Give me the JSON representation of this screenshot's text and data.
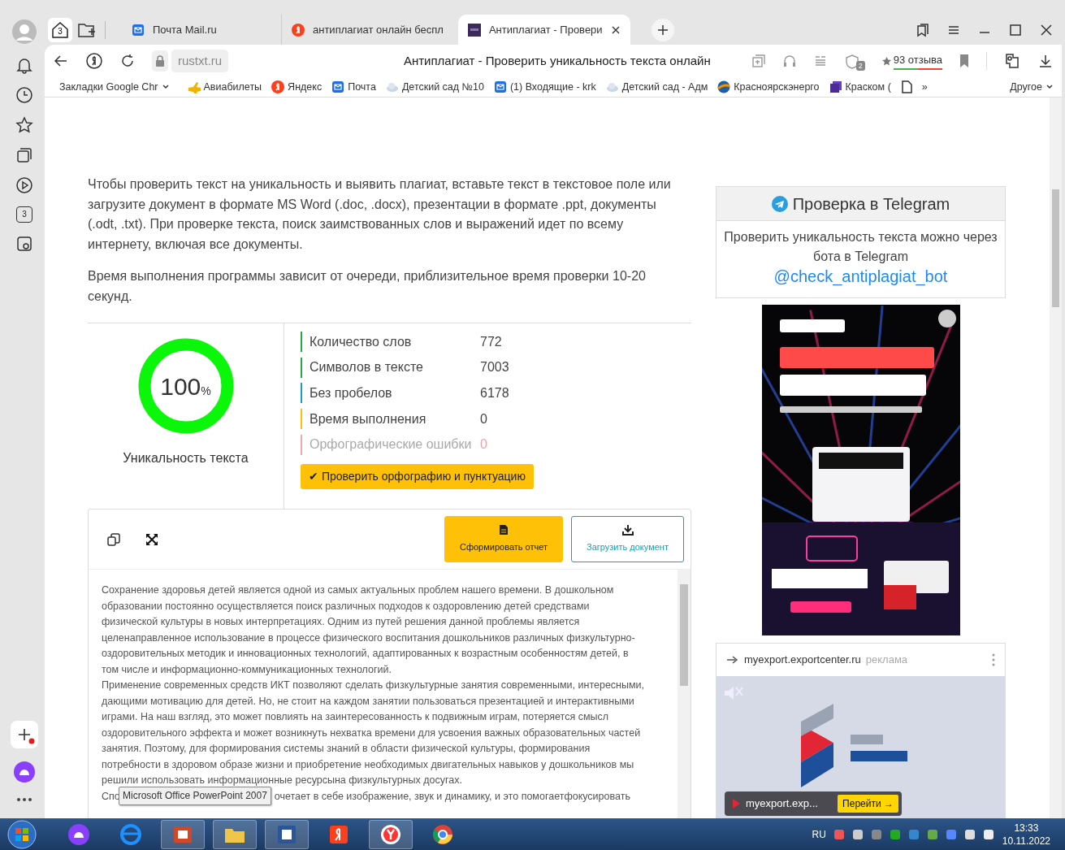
{
  "sidebar": {
    "tabs_badge": "3"
  },
  "tab_strip": {
    "group_badge": "3",
    "tabs": [
      {
        "title": "Почта Mail.ru",
        "selected": false
      },
      {
        "title": "антиплагиат онлайн беспл",
        "selected": false
      },
      {
        "title": "Антиплагиат - Провери",
        "selected": true
      }
    ]
  },
  "address_bar": {
    "url": "rustxt.ru",
    "page_title": "Антиплагиат - Проверить уникальность текста онлайн",
    "shield_count": "2",
    "reviews": "93 отзыва"
  },
  "bookmarks": {
    "items": [
      {
        "label": "Закладки Google Chr",
        "kind": "folder"
      },
      {
        "label": "Авиабилеты",
        "kind": "link"
      },
      {
        "label": "Яндекс",
        "kind": "link"
      },
      {
        "label": "Почта",
        "kind": "link"
      },
      {
        "label": "Детский сад №10",
        "kind": "link"
      },
      {
        "label": "(1) Входящие - krk",
        "kind": "link"
      },
      {
        "label": "Детский сад - Адм",
        "kind": "link"
      },
      {
        "label": "Красноярскэнерго",
        "kind": "link"
      },
      {
        "label": "Краском (",
        "kind": "link"
      }
    ],
    "more": "»",
    "other": "Другое"
  },
  "intro": [
    "Чтобы проверить текст на уникальность и выявить плагиат, вставьте текст в текстовое поле или загрузите документ в формате MS Word (.doc, .docx), презентации в формате .ppt, документы (.odt, .txt). При проверке текста, поиск заимствованных слов и выражений идет по всему интернету, включая все документы.",
    "Время выполнения программы зависит от очереди, приблизительное время проверки 10-20 секунд."
  ],
  "uniqueness": {
    "value": "100",
    "unit": "%",
    "level": 1,
    "label": "Уникальность текста"
  },
  "stats": [
    {
      "label": "Количество слов",
      "value": "772",
      "color": "#28a745",
      "disabled": false
    },
    {
      "label": "Символов в тексте",
      "value": "7003",
      "color": "#28a745",
      "disabled": false
    },
    {
      "label": "Без пробелов",
      "value": "6178",
      "color": "#17a2b8",
      "disabled": false
    },
    {
      "label": "Время выполнения",
      "value": "0",
      "color": "#ffc107",
      "disabled": false
    },
    {
      "label": "Орфографические ошибки",
      "value": "0",
      "color": "#f1a7ae",
      "disabled": true
    }
  ],
  "spell_button": {
    "icon": "✔",
    "label": "Проверить орфографию и пунктуацию"
  },
  "editor": {
    "buttons": [
      {
        "label": "Сформировать отчет",
        "kind": "primary"
      },
      {
        "label": "Загрузить документ",
        "kind": "outline"
      }
    ],
    "paragraphs": [
      "Сохранение здоровья детей является одной из самых актуальных проблем нашего времени. В дошкольном образовании постоянно осуществляется поиск различных подходов к оздоровлению детей средствами физической культуры в новых интерпретациях. Одним из путей решения данной проблемы является целенаправленное использование в процессе физического воспитания дошкольников различных физкультурно-оздоровительных методик и инновационных технологий, адаптированных к возрастным особенностям детей, в том числе и информационно-коммуникационных технологий.",
      "Применение современных средств ИКТ позволяют сделать физкультурные занятия современными, интересными, дающими мотивацию для детей. Но, не стоит на каждом занятии пользоваться презентацией и интерактивными играми. На наш взгляд, это может повлиять на заинтересованность к подвижным играм, потеряется смысл оздоровительного эффекта и может возникнуть нехватка времени для усвоения важных образовательных частей занятия. Поэтому, для формирования системы знаний в области физической культуры, формирования потребности в здоровом образе жизни и приобретение необходимых двигательных навыков у дошкольников мы решили использовать информационные ресурсына физкультурных досугах."
    ],
    "last_line_start": "Спо",
    "last_line_end": "очетает в себе изображение, звук и динамику, и это помогаетфокусировать"
  },
  "tooltip": "Microsoft Office PowerPoint 2007",
  "telegram": {
    "title": "Проверка в Telegram",
    "text": "Проверить уникальность текста можно через бота в Telegram",
    "link": "@check_antiplagiat_bot"
  },
  "ad_banner": {
    "kind": "picture"
  },
  "export_ad": {
    "domain": "myexport.exportcenter.ru",
    "tag": "реклама",
    "cta_site": "myexport.exp...",
    "cta_button": "Перейти →"
  },
  "taskbar": {
    "language": "RU",
    "time": "13:33",
    "date": "10.11.2022"
  }
}
